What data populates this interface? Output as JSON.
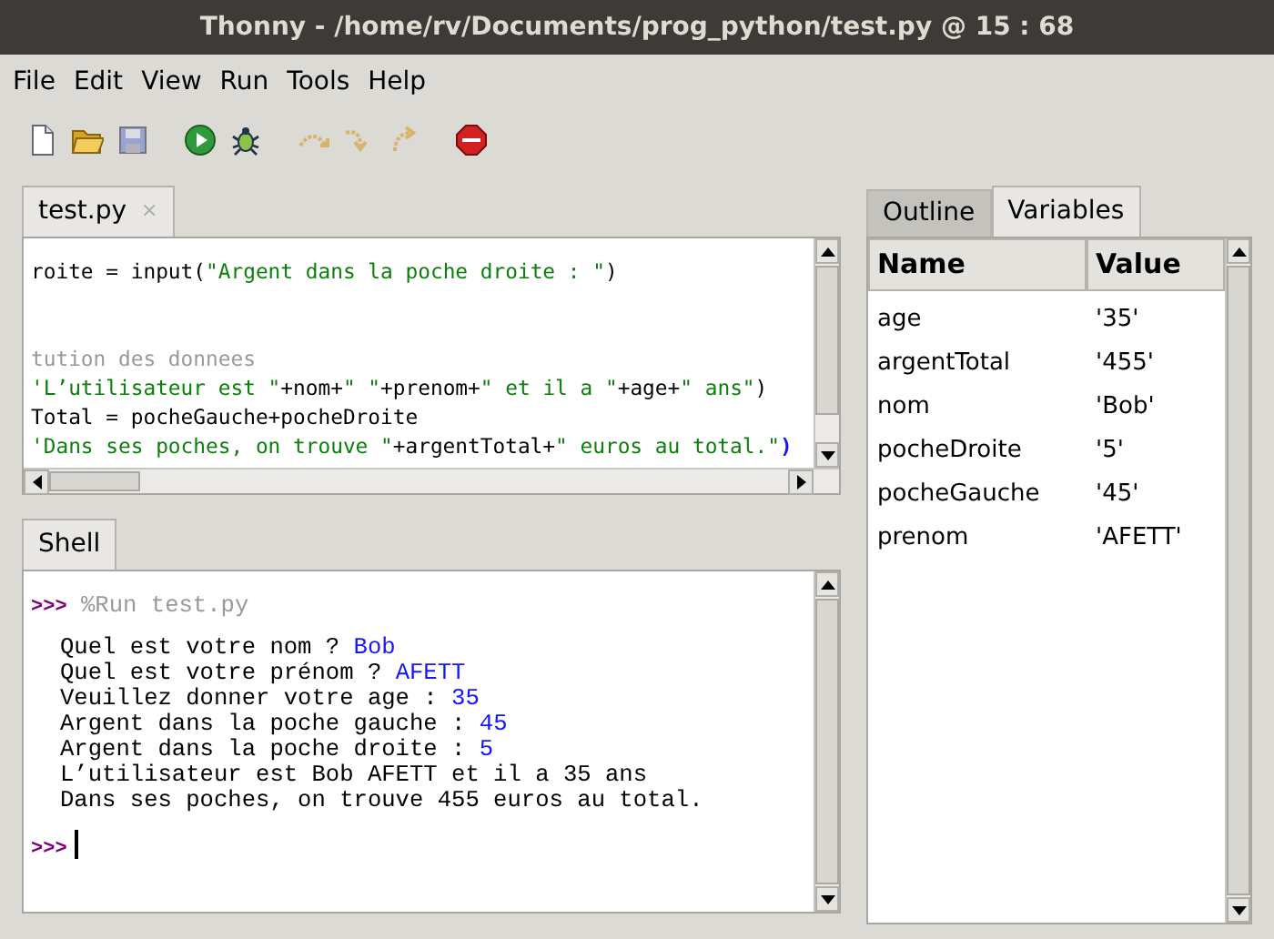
{
  "window": {
    "title": "Thonny  -  /home/rv/Documents/prog_python/test.py  @  15 : 68"
  },
  "menu": [
    "File",
    "Edit",
    "View",
    "Run",
    "Tools",
    "Help"
  ],
  "toolbar": [
    {
      "kind": "new",
      "disabled": false
    },
    {
      "kind": "open",
      "disabled": false
    },
    {
      "kind": "save",
      "disabled": true
    },
    {
      "kind": "run",
      "disabled": false
    },
    {
      "kind": "debug",
      "disabled": false
    },
    {
      "kind": "step-over",
      "disabled": true
    },
    {
      "kind": "step-into",
      "disabled": true
    },
    {
      "kind": "step-out",
      "disabled": true
    },
    {
      "kind": "stop",
      "disabled": false
    }
  ],
  "editor": {
    "tab": {
      "label": "test.py",
      "selected": true,
      "close": "×"
    },
    "lines": [
      [
        {
          "kind": "code",
          "text": "roite = input("
        },
        {
          "kind": "string",
          "text": "\"Argent dans la poche droite : \""
        },
        {
          "kind": "code",
          "text": ")"
        }
      ],
      [
        {
          "kind": "blank"
        }
      ],
      [
        {
          "kind": "blank"
        }
      ],
      [
        {
          "kind": "comment",
          "text": "tution des donnees"
        }
      ],
      [
        {
          "kind": "string",
          "text": "'L’utilisateur est \""
        },
        {
          "kind": "code",
          "text": "+nom+"
        },
        {
          "kind": "string",
          "text": "\" \""
        },
        {
          "kind": "code",
          "text": "+prenom+"
        },
        {
          "kind": "string",
          "text": "\" et il a \""
        },
        {
          "kind": "code",
          "text": "+age+"
        },
        {
          "kind": "string",
          "text": "\" ans\""
        },
        {
          "kind": "code",
          "text": ")"
        }
      ],
      [
        {
          "kind": "code",
          "text": "Total = pocheGauche+pocheDroite"
        }
      ],
      [
        {
          "kind": "string",
          "text": "'Dans ses poches, on trouve \""
        },
        {
          "kind": "code",
          "text": "+argentTotal+"
        },
        {
          "kind": "string",
          "text": "\" euros au total.\""
        },
        {
          "kind": "match",
          "text": ")"
        }
      ]
    ]
  },
  "shell": {
    "tab": {
      "label": "Shell",
      "selected": true
    },
    "lines": [
      {
        "kind": "command",
        "prompt": ">>>",
        "text": "%Run test.py"
      },
      {
        "kind": "blank"
      },
      {
        "kind": "output",
        "text": "Quel est votre nom ? ",
        "input": "Bob"
      },
      {
        "kind": "output",
        "text": "Quel est votre prénom ? ",
        "input": "AFETT"
      },
      {
        "kind": "output",
        "text": "Veuillez donner votre age : ",
        "input": "35"
      },
      {
        "kind": "output",
        "text": "Argent dans la poche gauche : ",
        "input": "45"
      },
      {
        "kind": "output",
        "text": "Argent dans la poche droite : ",
        "input": "5"
      },
      {
        "kind": "output",
        "text": "L’utilisateur est Bob AFETT et il a 35 ans"
      },
      {
        "kind": "output",
        "text": "Dans ses poches, on trouve 455 euros au total."
      },
      {
        "kind": "blank"
      },
      {
        "kind": "prompt",
        "prompt": ">>>"
      }
    ]
  },
  "side": {
    "tabs": [
      {
        "label": "Outline",
        "selected": false
      },
      {
        "label": "Variables",
        "selected": true
      }
    ],
    "columns": [
      "Name",
      "Value"
    ],
    "rows": [
      {
        "name": "age",
        "value": "'35'"
      },
      {
        "name": "argentTotal",
        "value": "'455'"
      },
      {
        "name": "nom",
        "value": "'Bob'"
      },
      {
        "name": "pocheDroite",
        "value": "'5'"
      },
      {
        "name": "pocheGauche",
        "value": "'45'"
      },
      {
        "name": "prenom",
        "value": "'AFETT'"
      }
    ]
  }
}
